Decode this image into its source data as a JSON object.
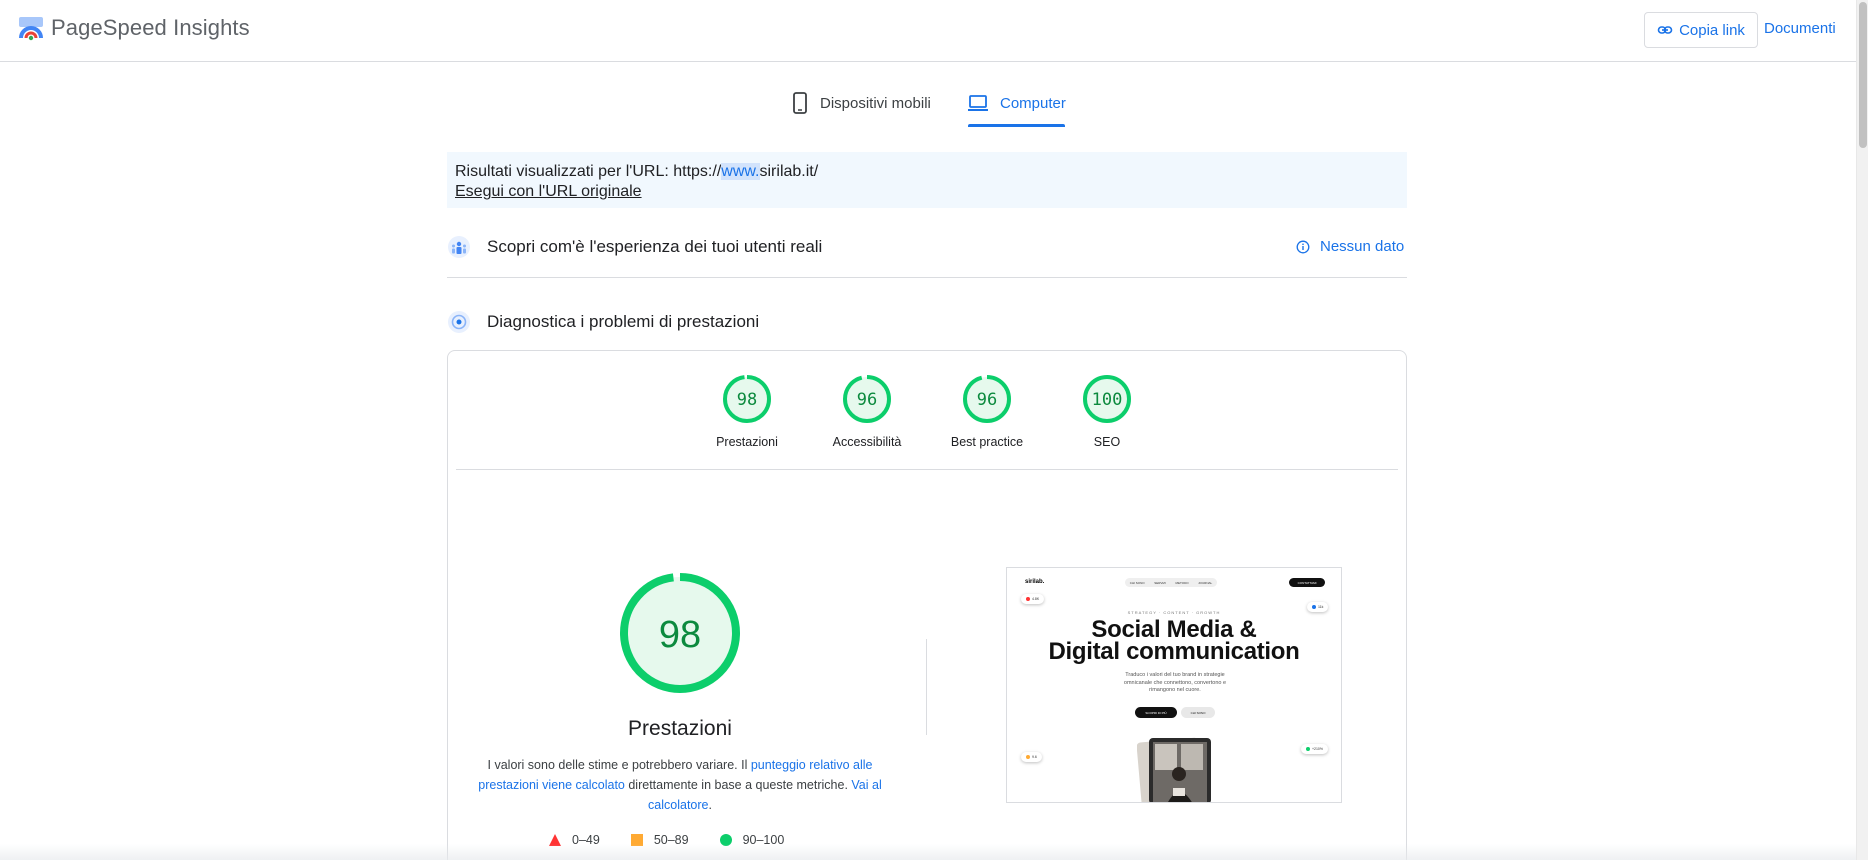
{
  "header": {
    "app_title": "PageSpeed Insights",
    "copy_link_label": "Copia link",
    "docs_label": "Documenti"
  },
  "tabs": [
    {
      "label": "Dispositivi mobili",
      "icon": "smartphone-icon",
      "selected": false
    },
    {
      "label": "Computer",
      "icon": "laptop-icon",
      "selected": true
    }
  ],
  "url_notice": {
    "prefix": "Risultati visualizzati per l'URL: https://",
    "highlight": "www.",
    "suffix": "sirilab.it/",
    "run_original_label": "Esegui con l'URL originale"
  },
  "ux_section": {
    "title": "Scopri com'è l'esperienza dei tuoi utenti reali",
    "status": "Nessun dato",
    "status_icon": "info-icon"
  },
  "diag_section": {
    "title": "Diagnostica i problemi di prestazioni"
  },
  "categories": [
    {
      "label": "Prestazioni",
      "score": "98",
      "fraction": 0.98
    },
    {
      "label": "Accessibilità",
      "score": "96",
      "fraction": 0.96
    },
    {
      "label": "Best practice",
      "score": "96",
      "fraction": 0.96
    },
    {
      "label": "SEO",
      "score": "100",
      "fraction": 1.0
    }
  ],
  "performance": {
    "score": "98",
    "fraction": 0.98,
    "title": "Prestazioni",
    "desc_part1": "I valori sono delle stime e potrebbero variare. Il ",
    "desc_link1": "punteggio relativo alle prestazioni viene calcolato",
    "desc_part2": " direttamente in base a queste metriche. ",
    "desc_link2": "Vai al calcolatore",
    "desc_part3": "."
  },
  "legend": [
    {
      "range": "0–49",
      "shape": "triangle",
      "color": "#ff3333"
    },
    {
      "range": "50–89",
      "shape": "square",
      "color": "#ffaa33"
    },
    {
      "range": "90–100",
      "shape": "circle",
      "color": "#0cce6b"
    }
  ],
  "preview": {
    "logo": "sirilab.",
    "nav": [
      "CHI SONO",
      "SERVIZI",
      "METODO",
      "JOURNAL"
    ],
    "cta": "CONTATTAMI",
    "kicker": "STRATEGY · CONTENT · GROWTH",
    "headline_line1": "Social Media &",
    "headline_line2": "Digital communication",
    "subtext": "Traduco i valori del tuo brand in strategie omnicanale che connettono, convertono e rimangono nel cuore.",
    "button_primary": "SCOPRI DI PIÙ",
    "button_secondary": "CHI SONO",
    "chips": [
      "4.8K",
      "11k",
      "9.6",
      "+210%"
    ]
  },
  "colors": {
    "accent": "#1a73e8",
    "pass": "#0cce6b",
    "pass_fill": "#e6f9ed",
    "pass_text": "#0c8a3e"
  }
}
